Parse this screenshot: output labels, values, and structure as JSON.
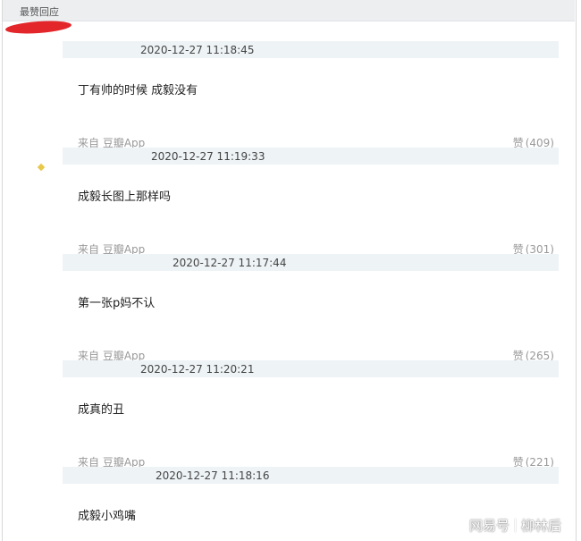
{
  "section": {
    "title": "最赞回应"
  },
  "comments": [
    {
      "timestamp": "2020-12-27 11:18:45",
      "content": "丁有帅的时候 成毅没有",
      "source": "来自 豆瓣App",
      "like_label": "赞",
      "like_count": "(409)"
    },
    {
      "timestamp": "2020-12-27 11:19:33",
      "content": "成毅长图上那样吗",
      "source": "来自 豆瓣App",
      "like_label": "赞",
      "like_count": "(301)"
    },
    {
      "timestamp": "2020-12-27 11:17:44",
      "content": "第一张p妈不认",
      "source": "来自 豆瓣App",
      "like_label": "赞",
      "like_count": "(265)"
    },
    {
      "timestamp": "2020-12-27 11:20:21",
      "content": "成真的丑",
      "source": "来自 豆瓣App",
      "like_label": "赞",
      "like_count": "(221)"
    },
    {
      "timestamp": "2020-12-27 11:18:16",
      "content": "成毅小鸡嘴",
      "source": "",
      "like_label": "",
      "like_count": ""
    }
  ],
  "watermark": {
    "brand": "网易号",
    "author": "柳林后"
  },
  "colors": {
    "highlight_mark": "#e3262a",
    "header_bg": "#eceef0",
    "meta_bar_bg": "#eef3f6"
  }
}
